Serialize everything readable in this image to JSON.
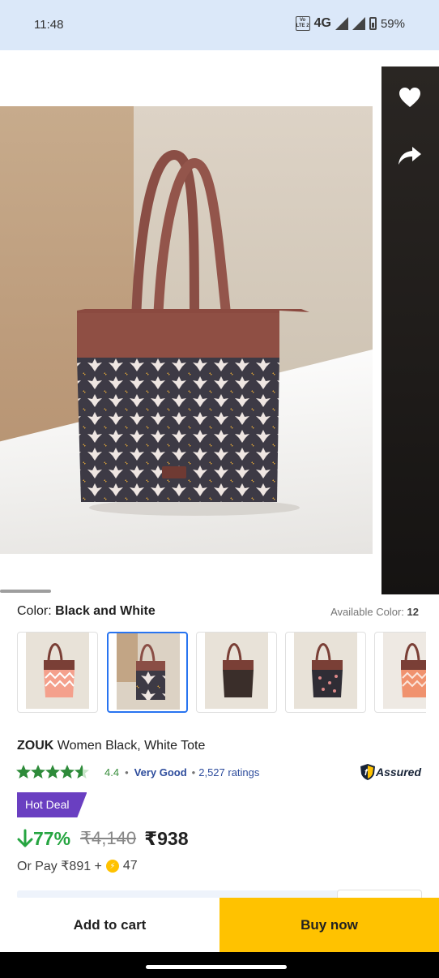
{
  "status_bar": {
    "time": "11:48",
    "volte": "Vo LTE 2",
    "network": "4G",
    "battery": "59%"
  },
  "gallery": {
    "wishlist_icon": "heart-icon",
    "share_icon": "share-icon"
  },
  "color": {
    "label": "Color:",
    "selected": "Black and White",
    "available_label": "Available Color:",
    "available_count": "12",
    "thumbnails": [
      {
        "pattern": "pink-chevron",
        "selected": false
      },
      {
        "pattern": "black-white-floral",
        "selected": true
      },
      {
        "pattern": "solid-black",
        "selected": false
      },
      {
        "pattern": "black-print",
        "selected": false
      },
      {
        "pattern": "orange-chevron",
        "selected": false
      }
    ]
  },
  "product": {
    "brand": "ZOUK",
    "name": "Women Black, White Tote",
    "rating": "4.4",
    "rating_label": "Very Good",
    "ratings_count": "2,527 ratings",
    "stars": 4.5,
    "assured": "Assured",
    "badge": "Hot Deal",
    "discount": "77%",
    "mrp": "₹4,140",
    "price": "₹938",
    "or_pay_prefix": "Or Pay ₹891 +",
    "coins": "47"
  },
  "actions": {
    "add_to_cart": "Add to cart",
    "buy_now": "Buy now"
  },
  "colors": {
    "primary_blue": "#2874f0",
    "buy_yellow": "#ffc200",
    "discount_green": "#26a541",
    "hot_deal_purple": "#6a3fc1",
    "star_green": "#388e3c"
  }
}
